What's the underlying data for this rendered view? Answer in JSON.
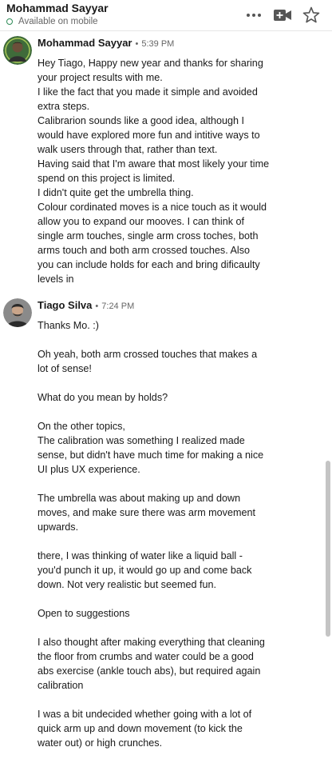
{
  "header": {
    "contact_name": "Mohammad Sayyar",
    "presence": "Available on mobile",
    "icons": [
      "more-options-icon",
      "video-call-icon",
      "star-icon"
    ]
  },
  "messages": [
    {
      "sender": "Mohammad Sayyar",
      "time": "5:39 PM",
      "separator": "•",
      "lines": [
        "Hey Tiago, Happy new year and thanks for sharing",
        "your project results with me.",
        "I like the fact that you made it simple and avoided",
        "extra steps.",
        "Calibrarion sounds like a good idea, although I",
        "would have explored more fun and intitive ways to",
        "walk users through that, rather than text.",
        "Having said that I'm aware that most likely your time",
        "spend on this project is limited.",
        "I didn't quite get the umbrella thing.",
        "Colour cordinated moves is a nice touch as it would",
        "allow you to expand our mooves. I can think of",
        "single arm touches, single arm cross toches, both",
        "arms touch and both arm crossed touches. Also",
        "you can include holds for each and bring dificaulty",
        "levels in"
      ]
    },
    {
      "sender": "Tiago Silva",
      "time": "7:24 PM",
      "separator": "•",
      "lines": [
        "Thanks Mo. :)",
        "",
        "Oh yeah, both arm crossed touches that makes a",
        "lot of sense!",
        "",
        "What do you mean by holds?",
        "",
        "On the other topics,",
        "The calibration was something I realized made",
        "sense, but didn't have much time for making a nice",
        "UI plus UX experience.",
        "",
        "The umbrella was about making up and down",
        "moves, and make sure there was arm movement",
        "upwards.",
        "",
        "there, I was thinking of water like a liquid ball -",
        "you'd punch it up, it would go up and come back",
        "down. Not very realistic but seemed fun.",
        "",
        "Open to suggestions",
        "",
        "I also thought after making everything that cleaning",
        "the floor from crumbs and water could be a good",
        "abs exercise (ankle touch abs), but required again",
        "calibration",
        "",
        "I was a bit undecided whether going with a lot of",
        "quick arm up and down movement (to kick the",
        "water out) or high crunches."
      ]
    }
  ],
  "colors": {
    "text": "#191919",
    "meta": "#666666",
    "presence": "#2e8b57",
    "scrollbar": "#c4c4c4"
  }
}
